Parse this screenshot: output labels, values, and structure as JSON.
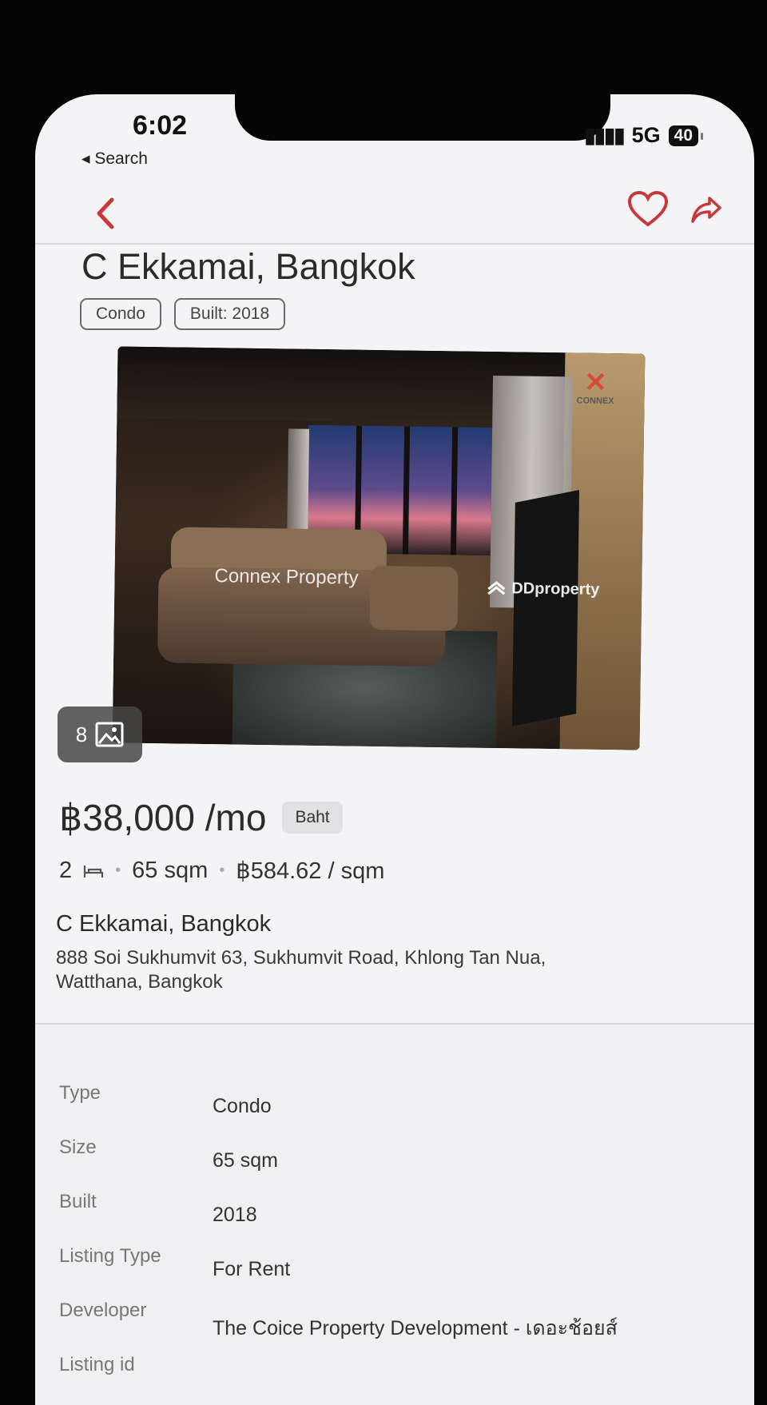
{
  "status_bar": {
    "time": "6:02",
    "back_label": "◂ Search",
    "network": "5G",
    "battery": "40"
  },
  "colors": {
    "accent": "#c8383a",
    "background": "#f4f4f6",
    "text": "#2b2b2b"
  },
  "nav": {
    "back_icon": "chevron-left-icon",
    "favorite_icon": "heart-icon",
    "share_icon": "share-icon"
  },
  "listing": {
    "title": "C Ekkamai, Bangkok",
    "tags": [
      "Condo",
      "Built: 2018"
    ],
    "photo": {
      "count": "8",
      "watermark_1": "Connex Property",
      "watermark_2": "DDproperty",
      "brand_logo_text": "CONNEX"
    },
    "price": "฿38,000 /mo",
    "currency": "Baht",
    "specs": {
      "bedrooms": "2",
      "size": "65 sqm",
      "price_per_sqm": "฿584.62 / sqm"
    },
    "address_name": "C Ekkamai, Bangkok",
    "address_full": "888 Soi Sukhumvit 63, Sukhumvit Road, Khlong Tan Nua, Watthana, Bangkok"
  },
  "details": [
    {
      "label": "Type",
      "value": "Condo"
    },
    {
      "label": "Size",
      "value": "65 sqm"
    },
    {
      "label": "Built",
      "value": "2018"
    },
    {
      "label": "Listing Type",
      "value": "For Rent"
    },
    {
      "label": "Developer",
      "value": "The Coice Property Development - เดอะช้อยส์"
    },
    {
      "label": "Listing id",
      "value": ""
    }
  ]
}
